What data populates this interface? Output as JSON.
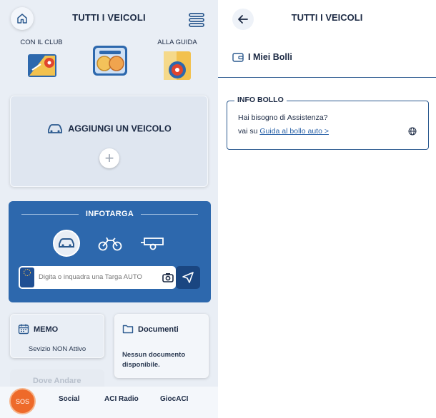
{
  "left_screen": {
    "title": "TUTTI I VEICOLI",
    "quick_links": [
      {
        "label": "CON IL CLUB",
        "icon": "club-map-icon"
      },
      {
        "label": "",
        "icon": "dashboard-icon"
      },
      {
        "label": "ALLA GUIDA",
        "icon": "driving-map-icon"
      }
    ],
    "add_vehicle": {
      "label": "AGGIUNGI UN VEICOLO",
      "plus": "+"
    },
    "infotarga": {
      "title": "INFOTARGA",
      "plate_placeholder": "Digita o inquadra una Targa AUTO",
      "vehicle_types": [
        "car",
        "motorcycle",
        "trailer"
      ]
    },
    "memo": {
      "title": "MEMO",
      "status": "Sevizio NON Attivo"
    },
    "documents": {
      "title": "Documenti",
      "status": "Nessun documento disponibile."
    },
    "dove_andare": {
      "title": "Dove Andare"
    },
    "bottom_nav": {
      "sos": "SOS",
      "items": [
        "Social",
        "ACI Radio",
        "GiocACI"
      ]
    }
  },
  "right_screen": {
    "title": "TUTTI I VEICOLI",
    "section": "I Miei Bolli",
    "info": {
      "legend": "INFO BOLLO",
      "question": "Hai bisogno di Assistenza?",
      "prefix": "vai su",
      "link": "Guida al bollo auto >"
    }
  },
  "colors": {
    "primary_blue": "#2d68ad",
    "dark_blue": "#1a4681",
    "sos_orange": "#ee6a2a",
    "text_dark": "#1c2a44",
    "link_blue": "#2a62a8"
  }
}
